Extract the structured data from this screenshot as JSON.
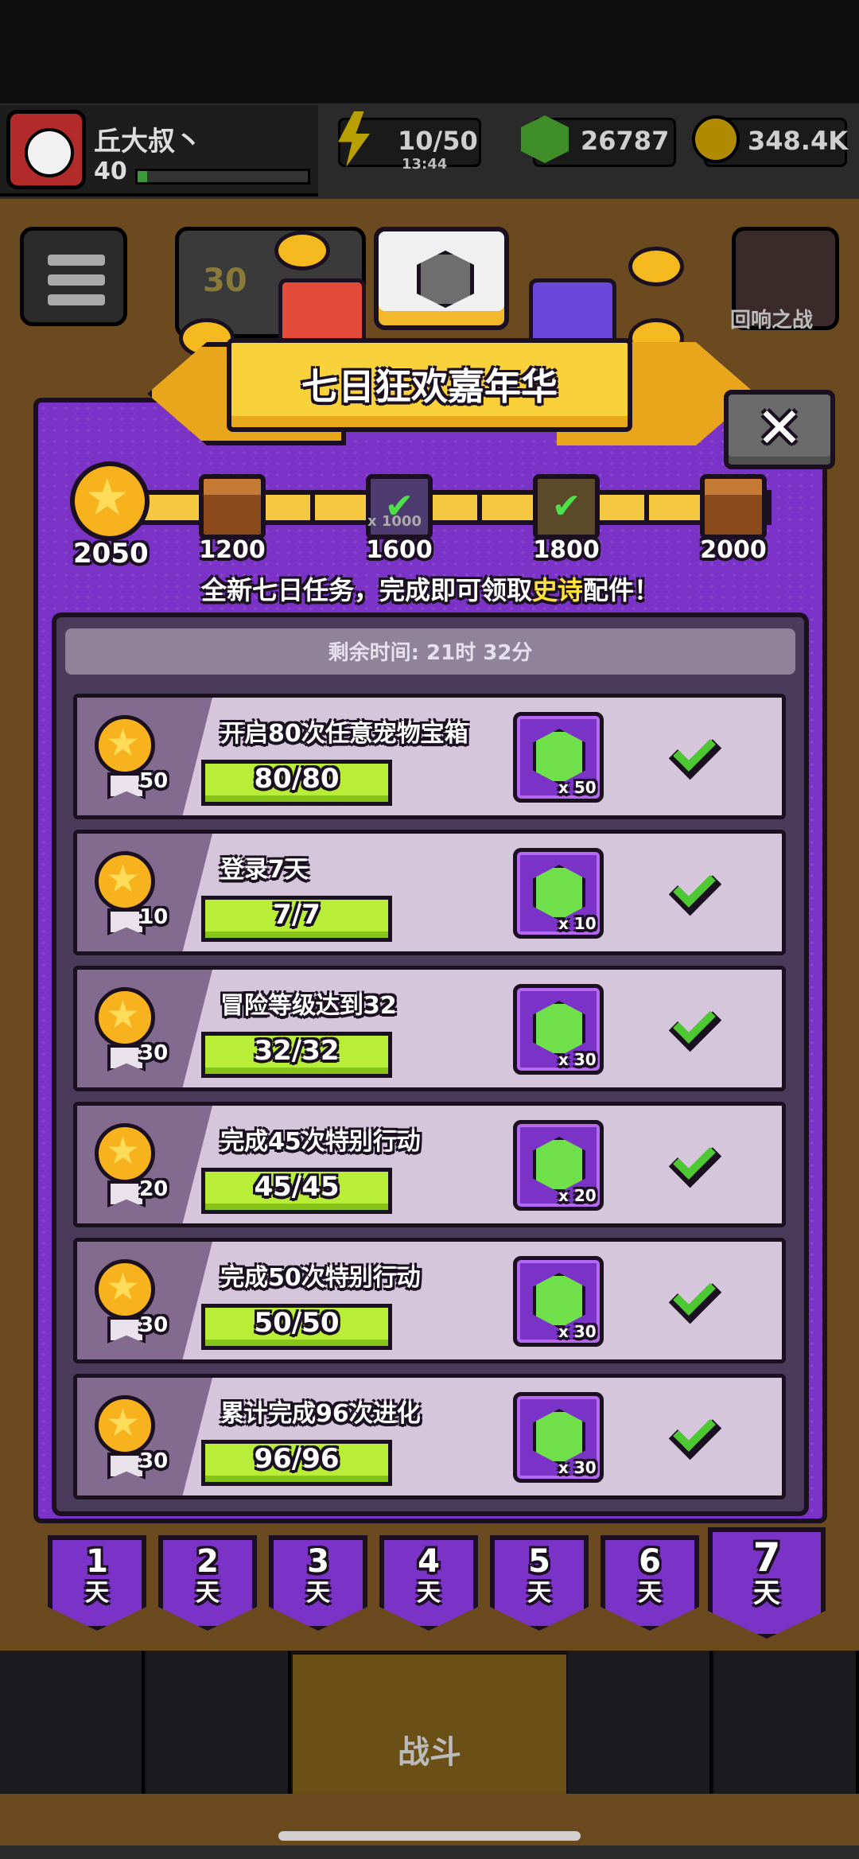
{
  "status_bar": {
    "player_name": "丘大叔丶",
    "player_level": "40",
    "energy": "10/50",
    "energy_timer": "13:44",
    "gems": "26787",
    "coins": "348.4K"
  },
  "background": {
    "level_badge": "30",
    "right_event_label": "回响之战"
  },
  "event": {
    "title": "七日狂欢嘉年华",
    "score": "2050",
    "milestones": [
      {
        "value": "1200",
        "state": "chest"
      },
      {
        "value": "1600",
        "state": "claimed",
        "badge": "x 1000"
      },
      {
        "value": "1800",
        "state": "claimed"
      },
      {
        "value": "2000",
        "state": "chest"
      }
    ],
    "subtitle_pre": "全新七日任务，完成即可领取",
    "subtitle_highlight": "史诗",
    "subtitle_post": "配件！",
    "timer": "剩余时间: 21时 32分"
  },
  "tasks": [
    {
      "title": "开启80次任意宠物宝箱",
      "points": "50",
      "progress": "80/80",
      "reward_qty": "x 50"
    },
    {
      "title": "登录7天",
      "points": "10",
      "progress": "7/7",
      "reward_qty": "x 10"
    },
    {
      "title": "冒险等级达到32",
      "points": "30",
      "progress": "32/32",
      "reward_qty": "x 30"
    },
    {
      "title": "完成45次特别行动",
      "points": "20",
      "progress": "45/45",
      "reward_qty": "x 20"
    },
    {
      "title": "完成50次特别行动",
      "points": "30",
      "progress": "50/50",
      "reward_qty": "x 30"
    },
    {
      "title": "累计完成96次进化",
      "points": "30",
      "progress": "96/96",
      "reward_qty": "x 30"
    }
  ],
  "days": [
    {
      "num": "1",
      "unit": "天"
    },
    {
      "num": "2",
      "unit": "天"
    },
    {
      "num": "3",
      "unit": "天"
    },
    {
      "num": "4",
      "unit": "天"
    },
    {
      "num": "5",
      "unit": "天"
    },
    {
      "num": "6",
      "unit": "天"
    },
    {
      "num": "7",
      "unit": "天"
    }
  ],
  "bottom_nav": {
    "battle_label": "战斗"
  },
  "colors": {
    "panel_purple": "#7a33c6",
    "banner_yellow": "#f9d13a",
    "progress_green": "#b8ee38",
    "outline": "#1b1020",
    "highlight": "#ffe23a"
  },
  "icons": [
    "star-icon",
    "chest-icon",
    "gem-icon",
    "check-icon",
    "close-icon",
    "energy-icon",
    "coin-icon",
    "menu-icon"
  ]
}
